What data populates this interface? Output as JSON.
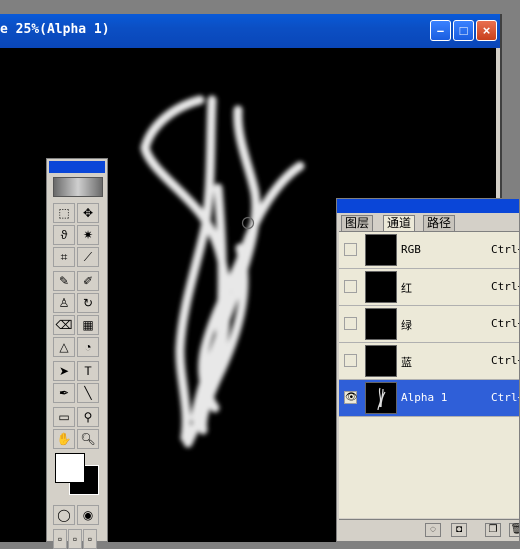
{
  "document": {
    "title": "e 25%(Alpha 1)",
    "buttons": {
      "minimize": "–",
      "maximize": "□",
      "close": "×"
    }
  },
  "toolbox": {
    "tools": [
      {
        "name": "marquee-tool",
        "glyph": "⬚"
      },
      {
        "name": "move-tool",
        "glyph": "✥"
      },
      {
        "name": "lasso-tool",
        "glyph": "ϑ"
      },
      {
        "name": "magic-wand-tool",
        "glyph": "✷"
      },
      {
        "name": "crop-tool",
        "glyph": "⌗"
      },
      {
        "name": "slice-tool",
        "glyph": "⟋"
      },
      {
        "name": "healing-brush-tool",
        "glyph": "✎"
      },
      {
        "name": "brush-tool",
        "glyph": "✐"
      },
      {
        "name": "clone-stamp-tool",
        "glyph": "♙"
      },
      {
        "name": "history-brush-tool",
        "glyph": "↻"
      },
      {
        "name": "eraser-tool",
        "glyph": "⌫"
      },
      {
        "name": "gradient-tool",
        "glyph": "▦"
      },
      {
        "name": "blur-tool",
        "glyph": "△"
      },
      {
        "name": "dodge-tool",
        "glyph": "◔"
      },
      {
        "name": "path-selection-tool",
        "glyph": "➤"
      },
      {
        "name": "type-tool",
        "glyph": "T"
      },
      {
        "name": "pen-tool",
        "glyph": "✒"
      },
      {
        "name": "line-tool",
        "glyph": "╲"
      },
      {
        "name": "notes-tool",
        "glyph": "▭"
      },
      {
        "name": "eyedropper-tool",
        "glyph": "⚲"
      },
      {
        "name": "hand-tool",
        "glyph": "✋"
      },
      {
        "name": "zoom-tool",
        "glyph": "🔍︎"
      }
    ]
  },
  "channels_panel": {
    "tabs": [
      {
        "label": "图层",
        "active": false
      },
      {
        "label": "通道",
        "active": true
      },
      {
        "label": "路径",
        "active": false
      }
    ],
    "rows": [
      {
        "name": "RGB",
        "shortcut": "Ctrl+",
        "visible": false,
        "selected": false
      },
      {
        "name": "红",
        "shortcut": "Ctrl+",
        "visible": false,
        "selected": false
      },
      {
        "name": "绿",
        "shortcut": "Ctrl+",
        "visible": false,
        "selected": false
      },
      {
        "name": "蓝",
        "shortcut": "Ctrl+",
        "visible": false,
        "selected": false
      },
      {
        "name": "Alpha 1",
        "shortcut": "Ctrl+",
        "visible": true,
        "selected": true
      }
    ],
    "bottom_buttons": [
      {
        "name": "load-selection-icon",
        "glyph": "◌"
      },
      {
        "name": "save-selection-icon",
        "glyph": "◘"
      },
      {
        "name": "new-channel-icon",
        "glyph": "❐"
      },
      {
        "name": "delete-channel-icon",
        "glyph": "🗑︎"
      }
    ],
    "eye_glyph": "👁︎"
  },
  "colors": {
    "title_blue": "#0a4fd0",
    "selection_blue": "#2f5fd8",
    "canvas": "#000000"
  }
}
